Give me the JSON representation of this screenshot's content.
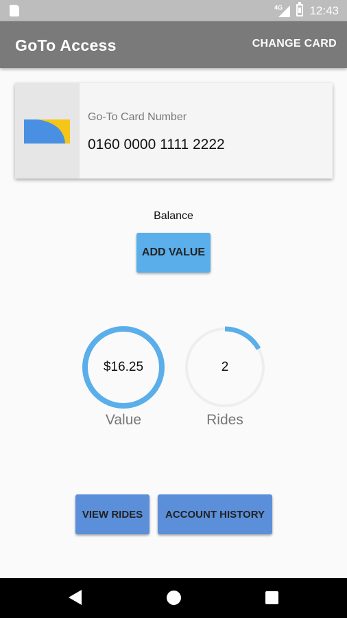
{
  "status_bar": {
    "network": "4G",
    "time": "12:43"
  },
  "app_bar": {
    "title": "GoTo Access",
    "change_card_label": "CHANGE CARD"
  },
  "card": {
    "label": "Go-To Card Number",
    "number": "0160 0000 1111 2222"
  },
  "balance": {
    "label": "Balance",
    "add_value_label": "ADD VALUE"
  },
  "gauges": {
    "value": {
      "text": "$16.25",
      "caption": "Value",
      "fraction": 1.0,
      "color": "#5aaeea"
    },
    "rides": {
      "text": "2",
      "caption": "Rides",
      "fraction": 0.17,
      "color": "#5aaeea"
    }
  },
  "actions": {
    "view_rides_label": "VIEW RIDES",
    "account_history_label": "ACCOUNT HISTORY"
  },
  "colors": {
    "app_bar": "#7a7a7a",
    "accent": "#5aaeea",
    "button_blue": "#5b8fd9",
    "card_yellow": "#f5c518",
    "card_blue": "#4a90e2"
  }
}
